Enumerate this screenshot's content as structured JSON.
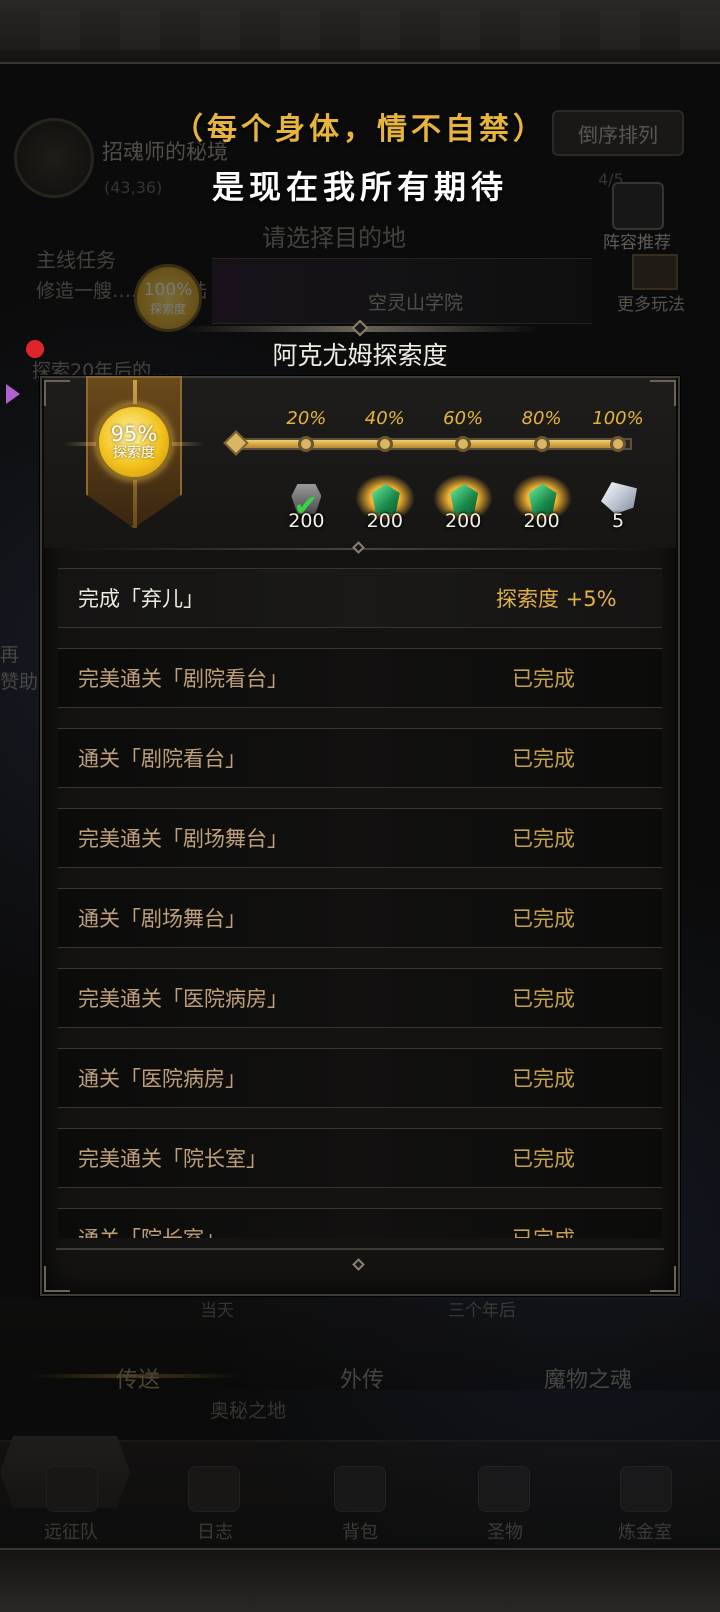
{
  "background": {
    "location_title": "招魂师的秘境",
    "coords": "(43,36)",
    "sort_button": "倒序排列",
    "count_text": "4/5",
    "lineup_label": "阵容推荐",
    "select_prompt": "请选择目的地",
    "main_quest_label": "主线任务",
    "main_quest_text": "修造一艘……的大陆",
    "medal_percent": "100%",
    "medal_label": "探索度",
    "destination": "空灵山学院",
    "more_label": "更多玩法",
    "task_text": "探索20年后的……",
    "side_text": "再 赞助",
    "list_info_left": "当天",
    "list_info_right": "三个年后",
    "tabs": [
      "传送",
      "外传",
      "魔物之魂"
    ],
    "land_label": "奥秘之地",
    "nav": [
      "远征队",
      "日志",
      "背包",
      "圣物",
      "炼金室"
    ]
  },
  "lyrics": {
    "line1": "（每个身体，情不自禁）",
    "line2": "是现在我所有期待"
  },
  "panel": {
    "title": "阿克尤姆探索度",
    "medal_percent": "95%",
    "medal_label": "探索度",
    "progress": 0.95,
    "milestones": [
      {
        "percent": "20%",
        "reward": "200",
        "icon": "chest-icon",
        "claimed": true
      },
      {
        "percent": "40%",
        "reward": "200",
        "icon": "emerald-icon",
        "claimed": false
      },
      {
        "percent": "60%",
        "reward": "200",
        "icon": "emerald-icon",
        "claimed": false
      },
      {
        "percent": "80%",
        "reward": "200",
        "icon": "emerald-icon",
        "claimed": false
      },
      {
        "percent": "100%",
        "reward": "5",
        "icon": "silver-ore-icon",
        "claimed": false
      }
    ],
    "rows": [
      {
        "label": "完成「弃儿」",
        "status": "探索度  +5%"
      },
      {
        "label": "完美通关「剧院看台」",
        "status": "已完成"
      },
      {
        "label": "通关「剧院看台」",
        "status": "已完成"
      },
      {
        "label": "完美通关「剧场舞台」",
        "status": "已完成"
      },
      {
        "label": "通关「剧场舞台」",
        "status": "已完成"
      },
      {
        "label": "完美通关「医院病房」",
        "status": "已完成"
      },
      {
        "label": "通关「医院病房」",
        "status": "已完成"
      },
      {
        "label": "完美通关「院长室」",
        "status": "已完成"
      },
      {
        "label": "通关「院长室」",
        "status": "已完成"
      }
    ]
  },
  "colors": {
    "gold": "#e5b53b",
    "accent_red": "#e0252a",
    "panel_bg": "#141312"
  }
}
